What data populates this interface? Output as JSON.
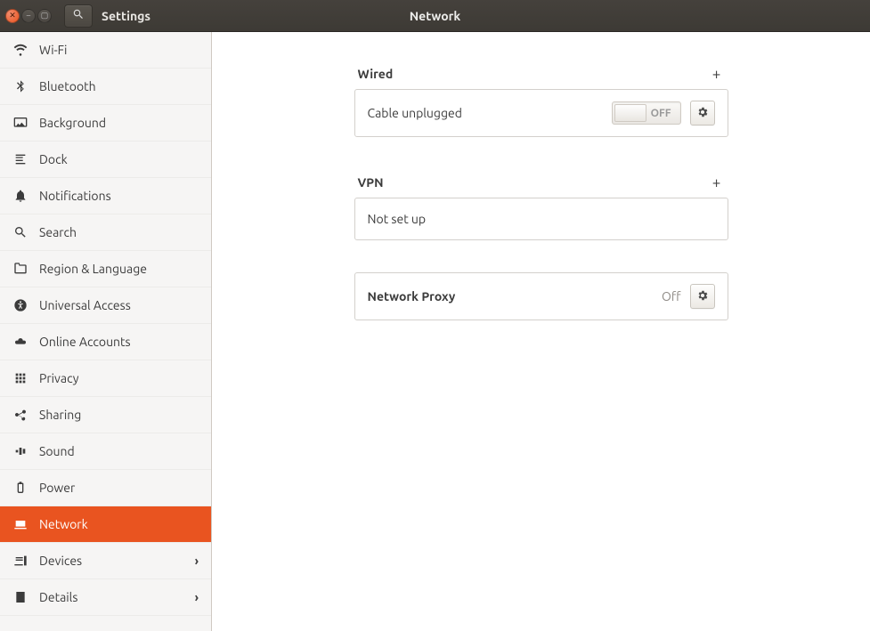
{
  "titlebar": {
    "app_name": "Settings",
    "page_title": "Network"
  },
  "sidebar": {
    "items": [
      {
        "id": "wifi",
        "label": "Wi-Fi",
        "expandable": false
      },
      {
        "id": "bluetooth",
        "label": "Bluetooth",
        "expandable": false
      },
      {
        "id": "background",
        "label": "Background",
        "expandable": false
      },
      {
        "id": "dock",
        "label": "Dock",
        "expandable": false
      },
      {
        "id": "notifications",
        "label": "Notifications",
        "expandable": false
      },
      {
        "id": "search",
        "label": "Search",
        "expandable": false
      },
      {
        "id": "region",
        "label": "Region & Language",
        "expandable": false
      },
      {
        "id": "universal",
        "label": "Universal Access",
        "expandable": false
      },
      {
        "id": "online",
        "label": "Online Accounts",
        "expandable": false
      },
      {
        "id": "privacy",
        "label": "Privacy",
        "expandable": false
      },
      {
        "id": "sharing",
        "label": "Sharing",
        "expandable": false
      },
      {
        "id": "sound",
        "label": "Sound",
        "expandable": false
      },
      {
        "id": "power",
        "label": "Power",
        "expandable": false
      },
      {
        "id": "network",
        "label": "Network",
        "expandable": false,
        "active": true
      },
      {
        "id": "devices",
        "label": "Devices",
        "expandable": true
      },
      {
        "id": "details",
        "label": "Details",
        "expandable": true
      }
    ]
  },
  "network": {
    "wired": {
      "heading": "Wired",
      "status": "Cable unplugged",
      "switch_state": "OFF"
    },
    "vpn": {
      "heading": "VPN",
      "status": "Not set up"
    },
    "proxy": {
      "heading": "Network Proxy",
      "state": "Off"
    }
  }
}
